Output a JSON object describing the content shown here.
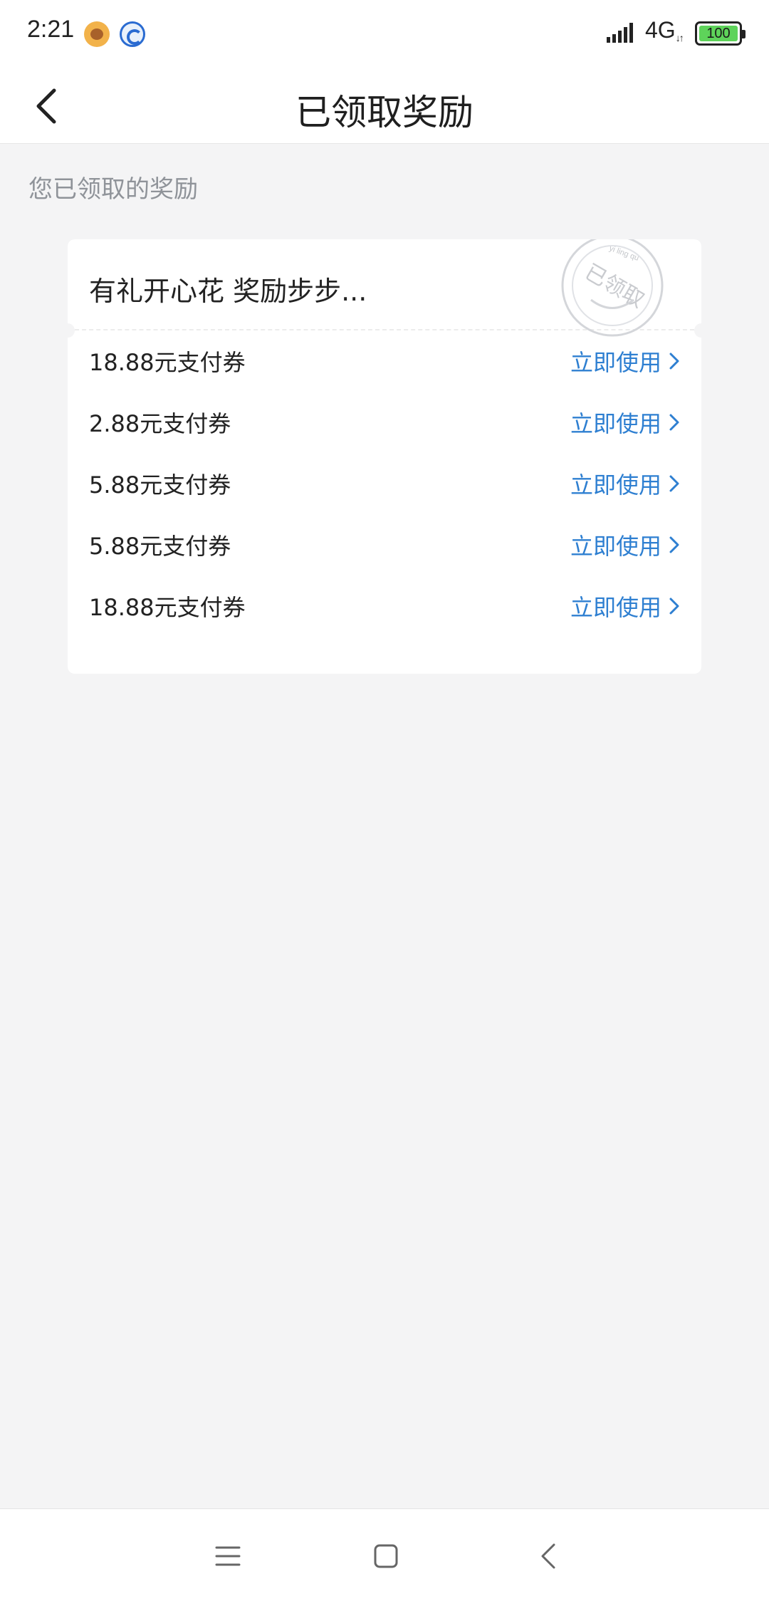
{
  "status_bar": {
    "time": "2:21",
    "network": "4G",
    "battery": "100",
    "icons": [
      "bear-app-icon",
      "blue-app-icon",
      "signal-icon",
      "battery-icon"
    ]
  },
  "header": {
    "title": "已领取奖励",
    "back_icon": "chevron-left-icon"
  },
  "section": {
    "label": "您已领取的奖励"
  },
  "card": {
    "title": "有礼开心花 奖励步步...",
    "stamp": {
      "text": "已领取",
      "pinyin": "yi ling qu"
    },
    "rewards": [
      {
        "name": "18.88元支付券",
        "action": "立即使用"
      },
      {
        "name": "2.88元支付券",
        "action": "立即使用"
      },
      {
        "name": "5.88元支付券",
        "action": "立即使用"
      },
      {
        "name": "5.88元支付券",
        "action": "立即使用"
      },
      {
        "name": "18.88元支付券",
        "action": "立即使用"
      }
    ]
  },
  "nav_bar": {
    "buttons": [
      "menu-icon",
      "home-icon",
      "back-icon"
    ]
  },
  "colors": {
    "accent": "#2e7fd1",
    "background": "#f4f4f5",
    "muted_text": "#8f9399"
  }
}
